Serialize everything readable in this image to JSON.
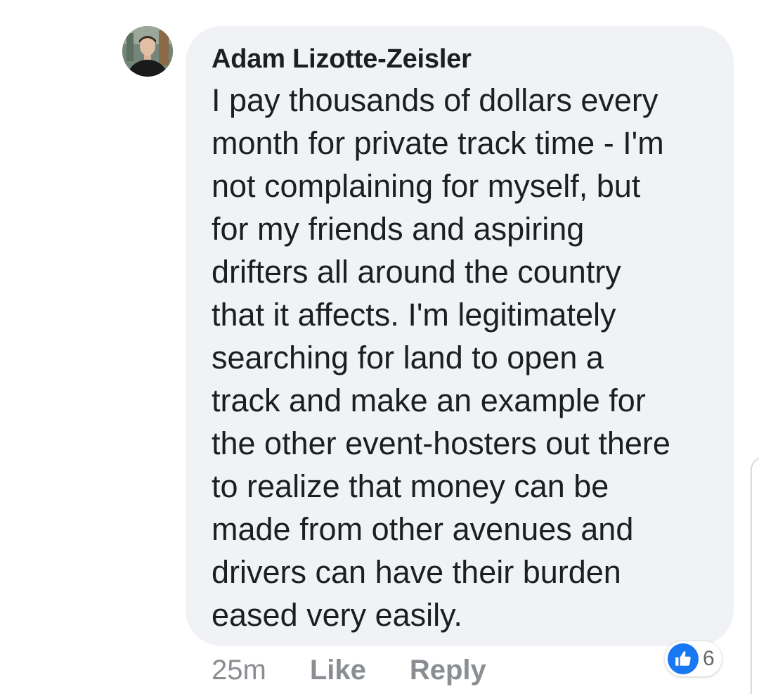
{
  "comment": {
    "author": "Adam Lizotte-Zeisler",
    "text": "I pay thousands of dollars every\nmonth for private track time - I'm\nnot complaining for myself, but\nfor my friends and aspiring\ndrifters all around the country\nthat it affects. I'm legitimately\nsearching for land to open a\ntrack and make an example for\nthe other event-hosters out there\nto realize that money can be\nmade from other avenues and\ndrivers can have their burden\neased very easily.",
    "avatar_icon": "avatar-photo"
  },
  "actions": {
    "time": "25m",
    "like_label": "Like",
    "reply_label": "Reply"
  },
  "reactions": {
    "icon": "thumbs-up-icon",
    "count": "6",
    "color": "#1877f2"
  }
}
